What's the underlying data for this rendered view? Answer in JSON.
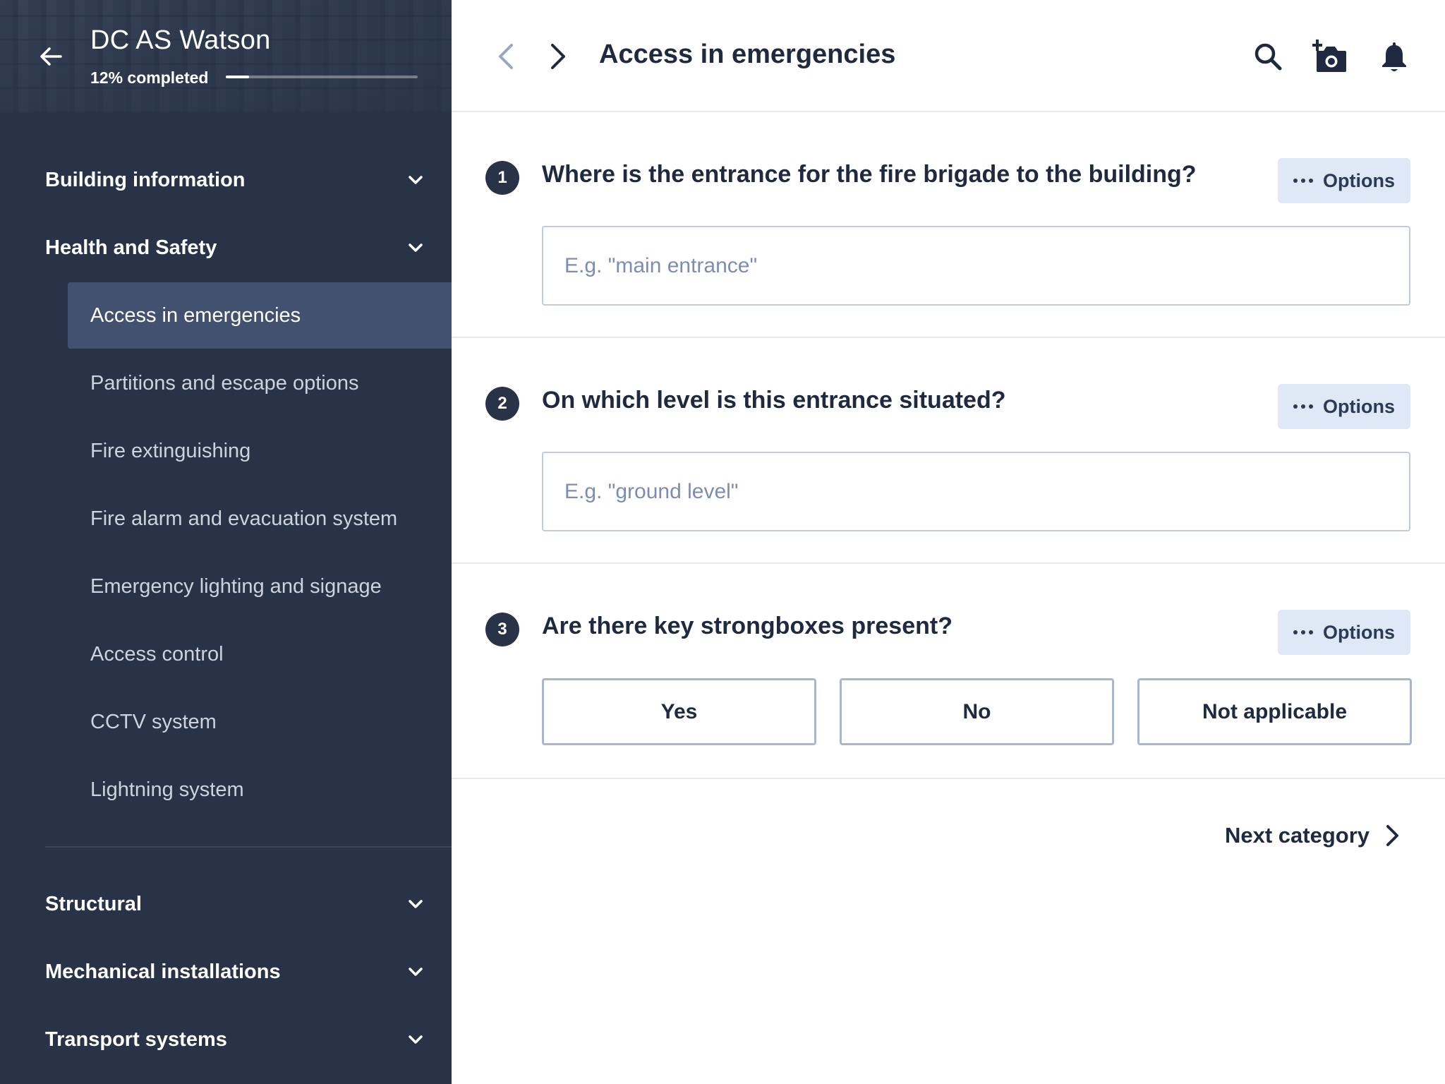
{
  "project": {
    "title": "DC AS Watson",
    "progress_text": "12% completed",
    "progress_fraction": 0.12
  },
  "sidebar": {
    "sections": [
      {
        "label": "Building information",
        "expanded": false
      },
      {
        "label": "Health and Safety",
        "expanded": true
      },
      {
        "label": "Structural",
        "expanded": false
      },
      {
        "label": "Mechanical installations",
        "expanded": false
      },
      {
        "label": "Transport systems",
        "expanded": false
      }
    ],
    "items": [
      {
        "label": "Access in emergencies",
        "active": true
      },
      {
        "label": "Partitions and escape options"
      },
      {
        "label": "Fire extinguishing"
      },
      {
        "label": "Fire alarm and evacuation system"
      },
      {
        "label": "Emergency lighting and signage"
      },
      {
        "label": "Access control"
      },
      {
        "label": "CCTV system"
      },
      {
        "label": "Lightning system"
      }
    ]
  },
  "header": {
    "title": "Access in emergencies",
    "icons": [
      "chevron-left-icon",
      "chevron-right-icon",
      "search-icon",
      "add-photo-icon",
      "bell-icon"
    ]
  },
  "questions": [
    {
      "number": "1",
      "text": "Where is the entrance for the fire brigade to the building?",
      "options_label": "Options",
      "placeholder": "E.g. \"main entrance\"",
      "value": ""
    },
    {
      "number": "2",
      "text": "On which level is this entrance situated?",
      "options_label": "Options",
      "placeholder": "E.g. \"ground level\"",
      "value": ""
    },
    {
      "number": "3",
      "text": "Are there key strongboxes present?",
      "options_label": "Options",
      "choices": [
        "Yes",
        "No",
        "Not applicable"
      ]
    }
  ],
  "footer": {
    "next_label": "Next category"
  },
  "colors": {
    "sidebar_bg": "#283347",
    "active_item_bg": "#435170",
    "options_bg": "#dfe8f7",
    "text_dark": "#1f2a40"
  }
}
